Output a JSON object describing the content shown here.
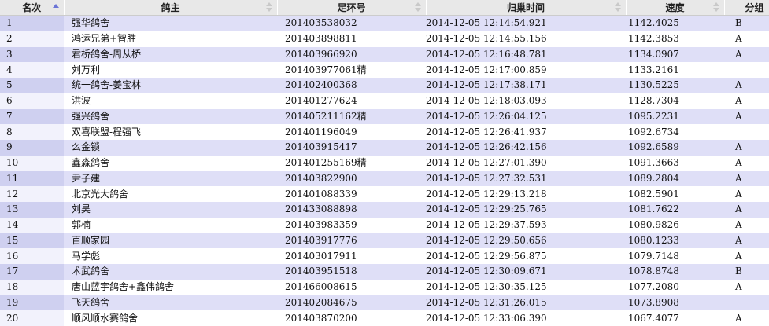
{
  "headers": [
    "名次",
    "鸽主",
    "足环号",
    "归巢时间",
    "速度",
    "分组"
  ],
  "rows": [
    [
      "1",
      "强华鸽舍",
      "201403538032",
      "2014-12-05 12:14:54.921",
      "1142.4025",
      "B"
    ],
    [
      "2",
      "鸿运兄弟+智胜",
      "201403898811",
      "2014-12-05 12:14:55.156",
      "1142.3853",
      "A"
    ],
    [
      "3",
      "君桥鸽舍-周从桥",
      "201403966920",
      "2014-12-05 12:16:48.781",
      "1134.0907",
      "A"
    ],
    [
      "4",
      "刘万利",
      "201403977061精",
      "2014-12-05 12:17:00.859",
      "1133.2161",
      ""
    ],
    [
      "5",
      "统一鸽舍-姜宝林",
      "201402400368",
      "2014-12-05 12:17:38.171",
      "1130.5225",
      "A"
    ],
    [
      "6",
      "洪波",
      "201401277624",
      "2014-12-05 12:18:03.093",
      "1128.7304",
      "A"
    ],
    [
      "7",
      "强兴鸽舍",
      "201405211162精",
      "2014-12-05 12:26:04.125",
      "1095.2231",
      "A"
    ],
    [
      "8",
      "双喜联盟-程强飞",
      "201401196049",
      "2014-12-05 12:26:41.937",
      "1092.6734",
      ""
    ],
    [
      "9",
      "么金锁",
      "201403915417",
      "2014-12-05 12:26:42.156",
      "1092.6589",
      "A"
    ],
    [
      "10",
      "鑫淼鸽舍",
      "201401255169精",
      "2014-12-05 12:27:01.390",
      "1091.3663",
      "A"
    ],
    [
      "11",
      "尹子建",
      "201403822900",
      "2014-12-05 12:27:32.531",
      "1089.2804",
      "A"
    ],
    [
      "12",
      "北京光大鸽舍",
      "201401088339",
      "2014-12-05 12:29:13.218",
      "1082.5901",
      "A"
    ],
    [
      "13",
      "刘昊",
      "201433088898",
      "2014-12-05 12:29:25.765",
      "1081.7622",
      "A"
    ],
    [
      "14",
      "郭楠",
      "201403983359",
      "2014-12-05 12:29:37.593",
      "1080.9826",
      "A"
    ],
    [
      "15",
      "百顺家园",
      "201403917776",
      "2014-12-05 12:29:50.656",
      "1080.1233",
      "A"
    ],
    [
      "16",
      "马学彪",
      "201403017911",
      "2014-12-05 12:29:56.875",
      "1079.7148",
      "A"
    ],
    [
      "17",
      "术武鸽舍",
      "201403951518",
      "2014-12-05 12:30:09.671",
      "1078.8748",
      "B"
    ],
    [
      "18",
      "唐山蓝宇鸽舍+鑫伟鸽舍",
      "201466008615",
      "2014-12-05 12:30:35.125",
      "1077.2080",
      "A"
    ],
    [
      "19",
      "飞天鸽舍",
      "201402084675",
      "2014-12-05 12:31:26.015",
      "1073.8908",
      ""
    ],
    [
      "20",
      "顺风顺水赛鸽舍",
      "201403870200",
      "2014-12-05 12:33:06.390",
      "1067.4077",
      "A"
    ]
  ]
}
